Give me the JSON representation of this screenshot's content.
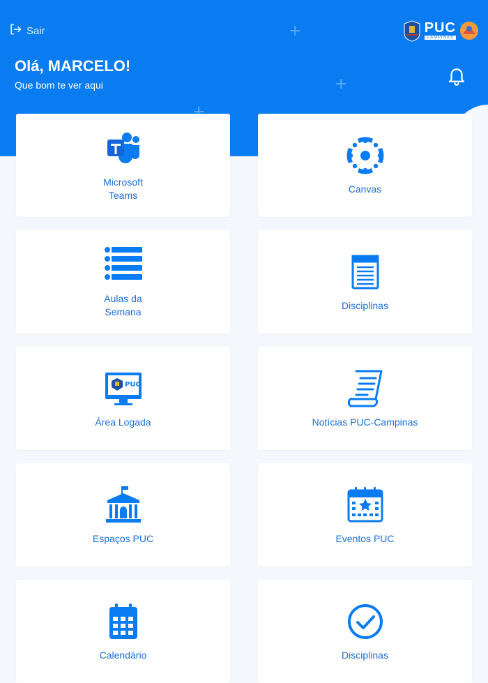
{
  "header": {
    "logout_label": "Sair",
    "logo_text": "PUC",
    "logo_subtext": "CAMPINAS",
    "greeting": "Olá, MARCELO!",
    "subtitle": "Que bom te ver aqui"
  },
  "colors": {
    "primary": "#0a7cf2",
    "background": "#f4f7fc",
    "card": "#ffffff",
    "label": "#1a6fd8"
  },
  "cards": [
    {
      "label": "Microsoft Teams",
      "icon": "microsoft-teams-icon"
    },
    {
      "label": "Canvas",
      "icon": "canvas-icon"
    },
    {
      "label": "Aulas da Semana",
      "icon": "list-icon"
    },
    {
      "label": "Disciplinas",
      "icon": "document-icon"
    },
    {
      "label": "Área Logada",
      "icon": "monitor-icon"
    },
    {
      "label": "Notícias PUC-Campinas",
      "icon": "news-scroll-icon"
    },
    {
      "label": "Espaços PUC",
      "icon": "building-icon"
    },
    {
      "label": "Eventos PUC",
      "icon": "event-calendar-icon"
    },
    {
      "label": "Calendário",
      "icon": "calendar-icon"
    },
    {
      "label": "Disciplinas",
      "icon": "check-circle-icon"
    }
  ]
}
